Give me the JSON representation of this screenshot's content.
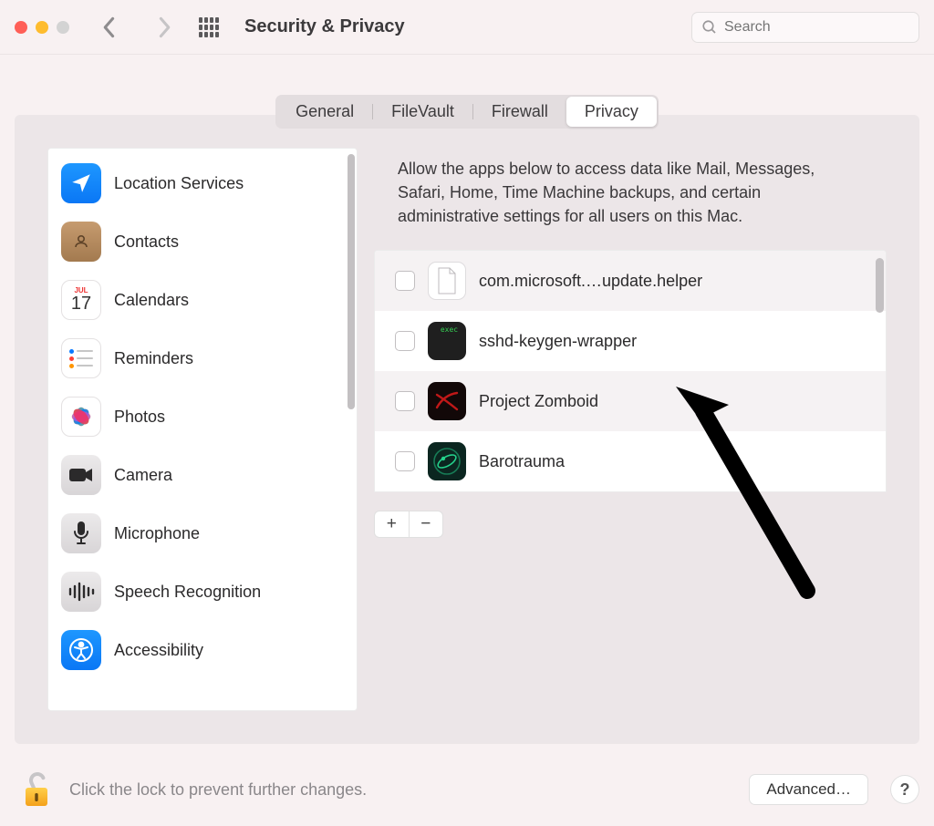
{
  "window": {
    "title": "Security & Privacy"
  },
  "search": {
    "placeholder": "Search"
  },
  "tabs": [
    {
      "label": "General"
    },
    {
      "label": "FileVault"
    },
    {
      "label": "Firewall"
    },
    {
      "label": "Privacy",
      "active": true
    }
  ],
  "sidebar": {
    "items": [
      {
        "label": "Location Services",
        "icon": "location"
      },
      {
        "label": "Contacts",
        "icon": "contacts"
      },
      {
        "label": "Calendars",
        "icon": "calendar",
        "badge_month": "JUL",
        "badge_day": "17"
      },
      {
        "label": "Reminders",
        "icon": "reminders"
      },
      {
        "label": "Photos",
        "icon": "photos"
      },
      {
        "label": "Camera",
        "icon": "camera"
      },
      {
        "label": "Microphone",
        "icon": "microphone"
      },
      {
        "label": "Speech Recognition",
        "icon": "speech"
      },
      {
        "label": "Accessibility",
        "icon": "accessibility"
      }
    ]
  },
  "detail": {
    "description": "Allow the apps below to access data like Mail, Messages, Safari, Home, Time Machine backups, and certain administrative settings for all users on this Mac.",
    "apps": [
      {
        "name": "com.microsoft.…update.helper",
        "icon": "document",
        "checked": false
      },
      {
        "name": "sshd-keygen-wrapper",
        "icon": "terminal",
        "checked": false
      },
      {
        "name": "Project Zomboid",
        "icon": "zomboid",
        "checked": false
      },
      {
        "name": "Barotrauma",
        "icon": "barotrauma",
        "checked": false
      }
    ]
  },
  "footer": {
    "lock_text": "Click the lock to prevent further changes.",
    "advanced_label": "Advanced…",
    "help_label": "?"
  }
}
